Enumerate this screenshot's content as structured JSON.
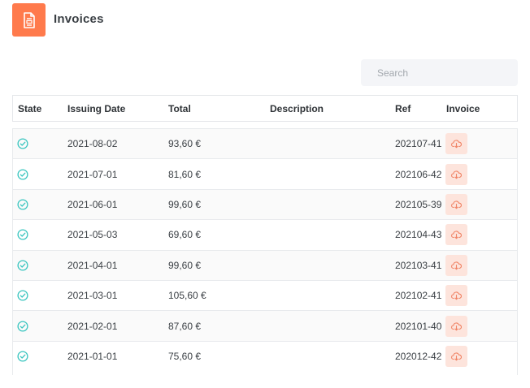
{
  "header": {
    "title": "Invoices",
    "icon": "invoice-document-icon",
    "accent_color": "#ff7a4c"
  },
  "search": {
    "placeholder": "Search",
    "value": ""
  },
  "table": {
    "columns": [
      "State",
      "Issuing Date",
      "Total",
      "Description",
      "Ref",
      "Invoice"
    ],
    "state_icon": "check-circle-icon",
    "state_color": "#3cc6c0",
    "download_icon": "cloud-download-icon",
    "download_color": "#fde4dc",
    "rows": [
      {
        "date": "2021-08-02",
        "total": "93,60 €",
        "description": "",
        "ref": "202107-41"
      },
      {
        "date": "2021-07-01",
        "total": "81,60 €",
        "description": "",
        "ref": "202106-42"
      },
      {
        "date": "2021-06-01",
        "total": "99,60 €",
        "description": "",
        "ref": "202105-39"
      },
      {
        "date": "2021-05-03",
        "total": "69,60 €",
        "description": "",
        "ref": "202104-43"
      },
      {
        "date": "2021-04-01",
        "total": "99,60 €",
        "description": "",
        "ref": "202103-41"
      },
      {
        "date": "2021-03-01",
        "total": "105,60 €",
        "description": "",
        "ref": "202102-41"
      },
      {
        "date": "2021-02-01",
        "total": "87,60 €",
        "description": "",
        "ref": "202101-40"
      },
      {
        "date": "2021-01-01",
        "total": "75,60 €",
        "description": "",
        "ref": "202012-42"
      }
    ]
  }
}
